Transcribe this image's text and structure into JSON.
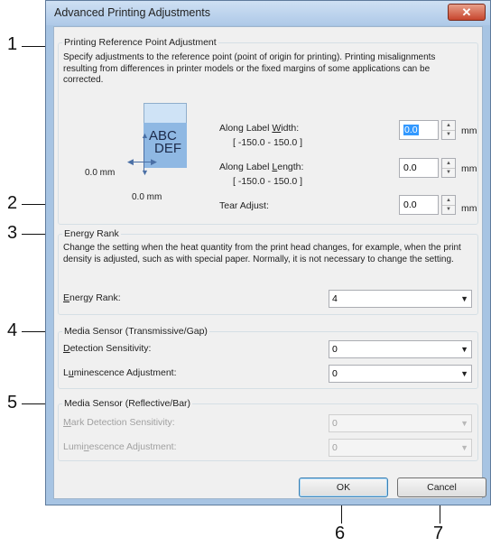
{
  "window": {
    "title": "Advanced Printing Adjustments",
    "close_symbol": "✕"
  },
  "printing_ref": {
    "group_label": "Printing Reference Point Adjustment",
    "description": "Specify adjustments to the reference point (point of origin for printing). Printing misalignments resulting from differences in printer models or the fixed margins of some applications can be corrected.",
    "illustration": {
      "text_line1": "ABC",
      "text_line2": "DEF",
      "offset_x": "0.0 mm",
      "offset_y": "0.0 mm"
    },
    "width": {
      "label_pre": "Along Label ",
      "label_key": "W",
      "label_post": "idth:",
      "range": "[ -150.0 - 150.0 ]",
      "value": "0.0",
      "unit": "mm"
    },
    "length": {
      "label_pre": "Along Label ",
      "label_key": "L",
      "label_post": "ength:",
      "range": "[ -150.0 - 150.0 ]",
      "value": "0.0",
      "unit": "mm"
    },
    "tear": {
      "label": "Tear Adjust:",
      "value": "0.0",
      "unit": "mm"
    }
  },
  "energy": {
    "group_label": "Energy Rank",
    "description": "Change the setting when the heat quantity from the print head changes, for example, when the print density is adjusted, such as with special paper. Normally, it is not necessary to change the setting.",
    "label_key": "E",
    "label_rest": "nergy Rank:",
    "value": "4"
  },
  "media_trans": {
    "group_label": "Media Sensor (Transmissive/Gap)",
    "detection": {
      "label_key": "D",
      "label_rest": "etection Sensitivity:",
      "value": "0"
    },
    "luminescence": {
      "label_pre": "L",
      "label_key": "u",
      "label_rest": "minescence Adjustment:",
      "value": "0"
    }
  },
  "media_refl": {
    "group_label": "Media Sensor (Reflective/Bar)",
    "mark": {
      "label_key": "M",
      "label_rest": "ark Detection Sensitivity:",
      "value": "0"
    },
    "luminescence": {
      "label_pre": "Lumi",
      "label_key": "n",
      "label_rest": "escence Adjustment:",
      "value": "0"
    }
  },
  "buttons": {
    "ok": "OK",
    "cancel": "Cancel"
  },
  "callouts": [
    "1",
    "2",
    "3",
    "4",
    "5",
    "6",
    "7"
  ]
}
